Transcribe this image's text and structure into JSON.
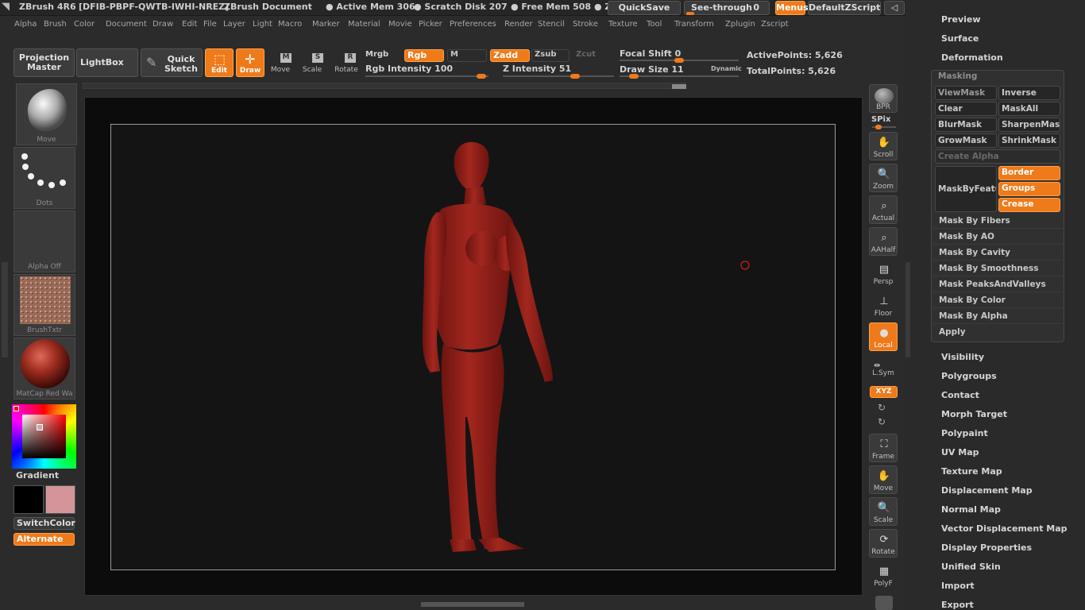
{
  "titlebar": {
    "app": "ZBrush 4R6",
    "serial": "[DFIB-PBPF-QWTB-IWHI-NREZ]",
    "doc": "ZBrush Document",
    "active_mem": "● Active Mem 306",
    "scratch": "● Scratch Disk 207",
    "free_mem": "● Free Mem 508",
    "z": "● Z",
    "quicksave": "QuickSave",
    "seethrough": "See-through",
    "seethrough_val": "0",
    "menus": "Menus",
    "zscript": "DefaultZScript"
  },
  "menubar": [
    "Alpha",
    "Brush",
    "Color",
    "Document",
    "Draw",
    "Edit",
    "File",
    "Layer",
    "Light",
    "Macro",
    "Marker",
    "Material",
    "Movie",
    "Picker",
    "Preferences",
    "Render",
    "Stencil",
    "Stroke",
    "Texture",
    "Tool",
    "Transform",
    "Zplugin",
    "Zscript"
  ],
  "toolbar": {
    "projection": "Projection Master",
    "lightbox": "LightBox",
    "quick_sketch": "Quick Sketch",
    "edit": "Edit",
    "draw": "Draw",
    "move": "Move",
    "scale": "Scale",
    "rotate": "Rotate",
    "mrgb": "Mrgb",
    "rgb": "Rgb",
    "m": "M",
    "zadd": "Zadd",
    "zsub": "Zsub",
    "zcut": "Zcut",
    "rgb_intensity": "Rgb Intensity 100",
    "z_intensity": "Z Intensity 51",
    "focal_shift": "Focal Shift 0",
    "draw_size": "Draw Size 11",
    "dynamic": "Dynamic",
    "active_points": "ActivePoints: 5,626",
    "total_points": "TotalPoints: 5,626",
    "rgb_intensity_value": 100,
    "z_intensity_value": 51
  },
  "leftpanel": {
    "brush": "Move",
    "stroke": "Dots",
    "alpha": "Alpha  Off",
    "texture": "BrushTxtr",
    "material": "MatCap  Red  Wa",
    "gradient": "Gradient",
    "switchcolor": "SwitchColor",
    "alternate": "Alternate"
  },
  "rightshelf": {
    "bpr": "BPR",
    "spix": "SPix",
    "scroll": "Scroll",
    "zoom": "Zoom",
    "actual": "Actual",
    "aahalf": "AAHalf",
    "persp": "Persp",
    "floor": "Floor",
    "local": "Local",
    "lsym": "L.Sym",
    "xyz": "XYZ",
    "frame": "Frame",
    "move": "Move",
    "scale": "Scale",
    "rotate": "Rotate",
    "polyf": "PolyF"
  },
  "toolpanel": {
    "top": [
      "Preview",
      "Surface",
      "Deformation"
    ],
    "masking_title": "Masking",
    "viewmask": "ViewMask",
    "inverse": "Inverse",
    "clear": "Clear",
    "maskall": "MaskAll",
    "blurmask": "BlurMask",
    "sharpenmask": "SharpenMask",
    "growmask": "GrowMask",
    "shrinkmask": "ShrinkMask",
    "create_alpha": "Create Alpha",
    "maskbyfeature": "MaskByFeature",
    "border": "Border",
    "groups": "Groups",
    "crease": "Crease",
    "mask_rows": [
      "Mask By Fibers",
      "Mask By AO",
      "Mask By Cavity",
      "Mask By Smoothness",
      "Mask PeaksAndValleys",
      "Mask By Color",
      "Mask By Alpha",
      "Apply"
    ],
    "bottom": [
      "Visibility",
      "Polygroups",
      "Contact",
      "Morph Target",
      "Polypaint",
      "UV Map",
      "Texture Map",
      "Displacement Map",
      "Normal Map",
      "Vector Displacement Map",
      "Display Properties",
      "Unified Skin",
      "Import",
      "Export"
    ]
  },
  "colors": {
    "accent": "#ef7a1a",
    "model": "#9b1f1a",
    "secondary_swatch": "#d4959a"
  }
}
